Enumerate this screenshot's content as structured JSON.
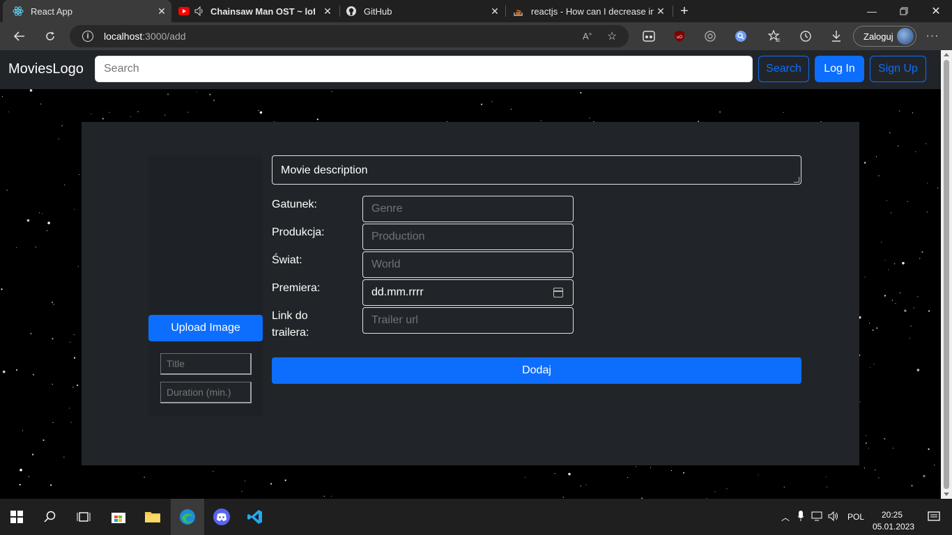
{
  "browser": {
    "tabs": [
      {
        "title": "React App",
        "active": true,
        "icon": "react-icon"
      },
      {
        "title": "Chainsaw Man OST ~ lofi hip hop",
        "active": false,
        "icon": "youtube-icon"
      },
      {
        "title": "GitHub",
        "active": false,
        "icon": "github-icon"
      },
      {
        "title": "reactjs - How can I decrease input",
        "active": false,
        "icon": "stackoverflow-icon"
      }
    ],
    "url_host": "localhost",
    "url_path": ":3000/add",
    "profile_label": "Zaloguj"
  },
  "navbar": {
    "brand": "MoviesLogo",
    "search_placeholder": "Search",
    "search_button": "Search",
    "login_button": "Log In",
    "signup_button": "Sign Up"
  },
  "form": {
    "upload_button": "Upload Image",
    "title_placeholder": "Title",
    "duration_placeholder": "Duration (min.)",
    "description": "Movie description",
    "fields": [
      {
        "label": "Gatunek:",
        "placeholder": "Genre"
      },
      {
        "label": "Produkcja:",
        "placeholder": "Production"
      },
      {
        "label": "Świat:",
        "placeholder": "World"
      },
      {
        "label": "Premiera:",
        "placeholder": "dd.mm.rrrr"
      },
      {
        "label": "Link do trailera:",
        "placeholder": "Trailer url"
      }
    ],
    "submit_button": "Dodaj"
  },
  "taskbar": {
    "language": "POL",
    "time": "20:25",
    "date": "05.01.2023"
  },
  "colors": {
    "primary": "#0d6efd",
    "navbar_bg": "#212529",
    "panel_bg": "#212529"
  }
}
